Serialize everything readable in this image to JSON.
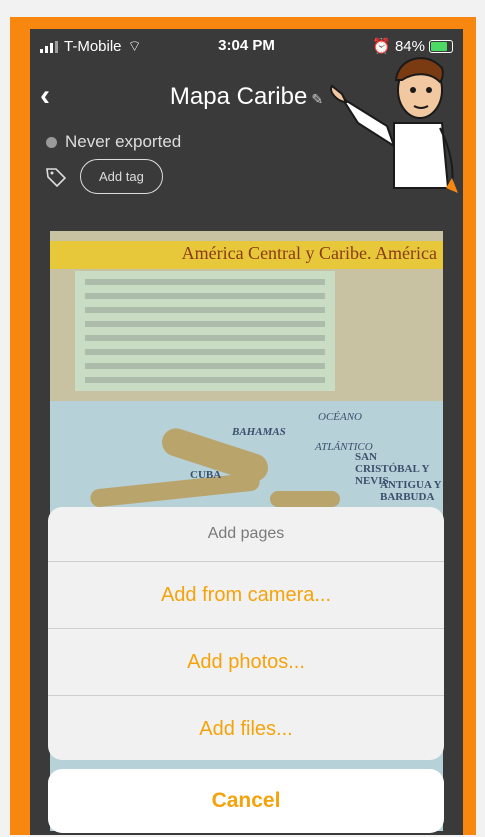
{
  "status": {
    "carrier": "T-Mobile",
    "time": "3:04 PM",
    "battery": "84%"
  },
  "header": {
    "title": "Mapa Caribe"
  },
  "document": {
    "export_status": "Never exported",
    "add_tag_label": "Add tag"
  },
  "map": {
    "heading": "América Central y Caribe. América",
    "labels": [
      "OCÉANO",
      "ATLÁNTICO",
      "BAHAMAS",
      "SAN CRISTÓBAL Y NEVIS",
      "ANTIGUA Y BARBUDA",
      "CUBA"
    ]
  },
  "sheet": {
    "title": "Add pages",
    "options": [
      "Add from camera...",
      "Add photos...",
      "Add files..."
    ],
    "cancel_label": "Cancel"
  },
  "colors": {
    "accent": "#f5a30a",
    "frame": "#f7870f",
    "background": "#3a3a3a"
  }
}
